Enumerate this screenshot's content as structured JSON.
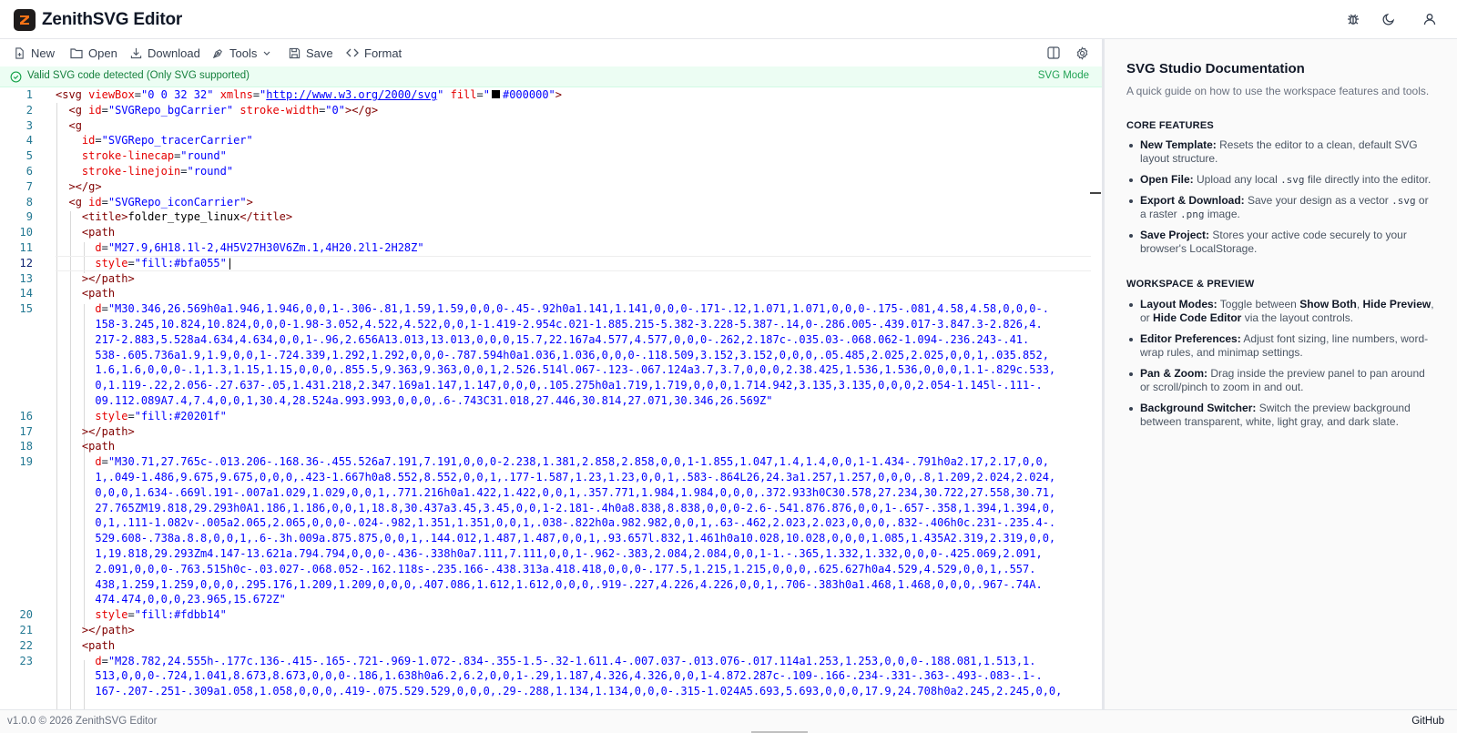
{
  "header": {
    "title": "ZenithSVG Editor",
    "logo_letter": "Z",
    "icons": [
      "bug-icon",
      "moon-icon",
      "user-icon"
    ]
  },
  "toolbar": {
    "new_label": "New",
    "open_label": "Open",
    "download_label": "Download",
    "tools_label": "Tools",
    "save_label": "Save",
    "format_label": "Format"
  },
  "status": {
    "message": "Valid SVG code detected (Only SVG supported)",
    "mode": "SVG Mode"
  },
  "editor": {
    "lines": [
      {
        "n": "1",
        "html": "<span class=\"punc\">&lt;</span><span class=\"tag\">svg</span> <span class=\"attr\">viewBox</span>=<span class=\"str\">\"0 0 32 32\"</span> <span class=\"attr\">xmlns</span>=<span class=\"str\">\"</span><span class=\"lnk\">http://www.w3.org/2000/svg</span><span class=\"str\">\"</span> <span class=\"attr\">fill</span>=<span class=\"str\">\"</span><span class=\"swatch\"></span><span class=\"str\">#000000\"</span><span class=\"punc\">&gt;</span>"
      },
      {
        "n": "2",
        "html": "  <span class=\"punc\">&lt;</span><span class=\"tag\">g</span> <span class=\"attr\">id</span>=<span class=\"str\">\"SVGRepo_bgCarrier\"</span> <span class=\"attr\">stroke-width</span>=<span class=\"str\">\"0\"</span><span class=\"punc\">&gt;&lt;/</span><span class=\"tag\">g</span><span class=\"punc\">&gt;</span>"
      },
      {
        "n": "3",
        "html": "  <span class=\"punc\">&lt;</span><span class=\"tag\">g</span>"
      },
      {
        "n": "4",
        "html": "    <span class=\"attr\">id</span>=<span class=\"str\">\"SVGRepo_tracerCarrier\"</span>"
      },
      {
        "n": "5",
        "html": "    <span class=\"attr\">stroke-linecap</span>=<span class=\"str\">\"round\"</span>"
      },
      {
        "n": "6",
        "html": "    <span class=\"attr\">stroke-linejoin</span>=<span class=\"str\">\"round\"</span>"
      },
      {
        "n": "7",
        "html": "  <span class=\"punc\">&gt;&lt;/</span><span class=\"tag\">g</span><span class=\"punc\">&gt;</span>"
      },
      {
        "n": "8",
        "html": "  <span class=\"punc\">&lt;</span><span class=\"tag\">g</span> <span class=\"attr\">id</span>=<span class=\"str\">\"SVGRepo_iconCarrier\"</span><span class=\"punc\">&gt;</span>"
      },
      {
        "n": "9",
        "html": "    <span class=\"punc\">&lt;</span><span class=\"tag\">title</span><span class=\"punc\">&gt;</span><span class=\"txt\">folder_type_linux</span><span class=\"punc\">&lt;/</span><span class=\"tag\">title</span><span class=\"punc\">&gt;</span>"
      },
      {
        "n": "10",
        "html": "    <span class=\"punc\">&lt;</span><span class=\"tag\">path</span>"
      },
      {
        "n": "11",
        "html": "      <span class=\"attr\">d</span>=<span class=\"str\">\"M27.9,6H18.1l-2,4H5V27H30V6Zm.1,4H20.2l1-2H28Z\"</span>"
      },
      {
        "n": "12",
        "html": "      <span class=\"attr\">style</span>=<span class=\"str\">\"fill:#bfa055\"</span><span class=\"txt\">|</span>"
      },
      {
        "n": "13",
        "html": "    <span class=\"punc\">&gt;&lt;/</span><span class=\"tag\">path</span><span class=\"punc\">&gt;</span>"
      },
      {
        "n": "14",
        "html": "    <span class=\"punc\">&lt;</span><span class=\"tag\">path</span>"
      },
      {
        "n": "15",
        "html": "      <span class=\"attr\">d</span>=<span class=\"str\">\"M30.346,26.569h0a1.946,1.946,0,0,1-.306-.81,1.59,1.59,0,0,0-.45-.92h0a1.141,1.141,0,0,0-.171-.12,1.071,1.071,0,0,0-.175-.081,4.58,4.58,0,0,0-.</span>"
      },
      {
        "n": "",
        "html": "      <span class=\"str\">158-3.245,10.824,10.824,0,0,0-1.98-3.052,4.522,4.522,0,0,1-1.419-2.954c.021-1.885.215-5.382-3.228-5.387-.14,0-.286.005-.439.017-3.847.3-2.826,4.</span>"
      },
      {
        "n": "",
        "html": "      <span class=\"str\">217-2.883,5.528a4.634,4.634,0,0,1-.96,2.656A13.013,13.013,0,0,0,15.7,22.167a4.577,4.577,0,0,0-.262,2.187c-.035.03-.068.062-1.094-.236.243-.41.</span>"
      },
      {
        "n": "",
        "html": "      <span class=\"str\">538-.605.736a1.9,1.9,0,0,1-.724.339,1.292,1.292,0,0,0-.787.594h0a1.036,1.036,0,0,0-.118.509,3.152,3.152,0,0,0,.05.485,2.025,2.025,0,0,1,.035.852,</span>"
      },
      {
        "n": "",
        "html": "      <span class=\"str\">1.6,1.6,0,0,0-.1,1.3,1.15,1.15,0,0,0,.855.5,9.363,9.363,0,0,1,2.526.514l.067-.123-.067.124a3.7,3.7,0,0,0,2.38.425,1.536,1.536,0,0,0,1.1-.829c.533,</span>"
      },
      {
        "n": "",
        "html": "      <span class=\"str\">0,1.119-.22,2.056-.27.637-.05,1.431.218,2.347.169a1.147,1.147,0,0,0,.105.275h0a1.719,1.719,0,0,0,1.714.942,3.135,3.135,0,0,0,2.054-1.145l-.111-.</span>"
      },
      {
        "n": "",
        "html": "      <span class=\"str\">09.112.089A7.4,7.4,0,0,1,30.4,28.524a.993.993,0,0,0,.6-.743C31.018,27.446,30.814,27.071,30.346,26.569Z\"</span>"
      },
      {
        "n": "16",
        "html": "      <span class=\"attr\">style</span>=<span class=\"str\">\"fill:#20201f\"</span>"
      },
      {
        "n": "17",
        "html": "    <span class=\"punc\">&gt;&lt;/</span><span class=\"tag\">path</span><span class=\"punc\">&gt;</span>"
      },
      {
        "n": "18",
        "html": "    <span class=\"punc\">&lt;</span><span class=\"tag\">path</span>"
      },
      {
        "n": "19",
        "html": "      <span class=\"attr\">d</span>=<span class=\"str\">\"M30.71,27.765c-.013.206-.168.36-.455.526a7.191,7.191,0,0,0-2.238,1.381,2.858,2.858,0,0,1-1.855,1.047,1.4,1.4,0,0,1-1.434-.791h0a2.17,2.17,0,0,</span>"
      },
      {
        "n": "",
        "html": "      <span class=\"str\">1,.049-1.486,9.675,9.675,0,0,0,.423-1.667h0a8.552,8.552,0,0,1,.177-1.587,1.23,1.23,0,0,1,.583-.864L26,24.3a1.257,1.257,0,0,0,.8,1.209,2.024,2.024,</span>"
      },
      {
        "n": "",
        "html": "      <span class=\"str\">0,0,0,1.634-.669l.191-.007a1.029,1.029,0,0,1,.771.216h0a1.422,1.422,0,0,1,.357.771,1.984,1.984,0,0,0,.372.933h0C30.578,27.234,30.722,27.558,30.71,</span>"
      },
      {
        "n": "",
        "html": "      <span class=\"str\">27.765ZM19.818,29.293h0A1.186,1.186,0,0,1,18.8,30.437a3.45,3.45,0,0,1-2.181-.4h0a8.838,8.838,0,0,0-2.6-.541.876.876,0,0,1-.657-.358,1.394,1.394,0,</span>"
      },
      {
        "n": "",
        "html": "      <span class=\"str\">0,1,.111-1.082v-.005a2.065,2.065,0,0,0-.024-.982,1.351,1.351,0,0,1,.038-.822h0a.982.982,0,0,1,.63-.462,2.023,2.023,0,0,0,.832-.406h0c.231-.235.4-.</span>"
      },
      {
        "n": "",
        "html": "      <span class=\"str\">529.608-.738a.8.8,0,0,1,.6-.3h.009a.875.875,0,0,1,.144.012,1.487,1.487,0,0,1,.93.657l.832,1.461h0a10.028,10.028,0,0,0,1.085,1.435A2.319,2.319,0,0,</span>"
      },
      {
        "n": "",
        "html": "      <span class=\"str\">1,19.818,29.293Zm4.147-13.621a.794.794,0,0,0-.436-.338h0a7.111,7.111,0,0,1-.962-.383,2.084,2.084,0,0,1-1.-.365,1.332,1.332,0,0,0-.425.069,2.091,</span>"
      },
      {
        "n": "",
        "html": "      <span class=\"str\">2.091,0,0,0-.763.515h0c-.03.027-.068.052-.162.118s-.235.166-.438.313a.418.418,0,0,0-.177.5,1.215,1.215,0,0,0,.625.627h0a4.529,4.529,0,0,1,.557.</span>"
      },
      {
        "n": "",
        "html": "      <span class=\"str\">438,1.259,1.259,0,0,0,.295.176,1.209,1.209,0,0,0,.407.086,1.612,1.612,0,0,0,.919-.227,4.226,4.226,0,0,1,.706-.383h0a1.468,1.468,0,0,0,.967-.74A.</span>"
      },
      {
        "n": "",
        "html": "      <span class=\"str\">474.474,0,0,0,23.965,15.672Z\"</span>"
      },
      {
        "n": "20",
        "html": "      <span class=\"attr\">style</span>=<span class=\"str\">\"fill:#fdbb14\"</span>"
      },
      {
        "n": "21",
        "html": "    <span class=\"punc\">&gt;&lt;/</span><span class=\"tag\">path</span><span class=\"punc\">&gt;</span>"
      },
      {
        "n": "22",
        "html": "    <span class=\"punc\">&lt;</span><span class=\"tag\">path</span>"
      },
      {
        "n": "23",
        "html": "      <span class=\"attr\">d</span>=<span class=\"str\">\"M28.782,24.555h-.177c.136-.415-.165-.721-.969-1.072-.834-.355-1.5-.32-1.611.4-.007.037-.013.076-.017.114a1.253,1.253,0,0,0-.188.081,1.513,1.</span>"
      },
      {
        "n": "",
        "html": "      <span class=\"str\">513,0,0,0-.724,1.041,8.673,8.673,0,0,0-.186,1.638h0a6.2,6.2,0,0,1-.29,1.187,4.326,4.326,0,0,1-4.872.287c-.109-.166-.234-.331-.363-.493-.083-.1-.</span>"
      },
      {
        "n": "",
        "html": "      <span class=\"str\">167-.207-.251-.309a1.058,1.058,0,0,0,.419-.075.529.529,0,0,0,.29-.288,1.134,1.134,0,0,0-.315-1.024A5.693,5.693,0,0,0,17.9,24.708h0a2.245,2.245,0,0,</span>"
      }
    ]
  },
  "docs": {
    "title": "SVG Studio Documentation",
    "subtitle": "A quick guide on how to use the workspace features and tools.",
    "core_heading": "CORE FEATURES",
    "core_items": [
      {
        "term": "New Template:",
        "text": " Resets the editor to a clean, default SVG layout structure."
      },
      {
        "term": "Open File:",
        "text": " Upload any local <span class=\"mono\">.svg</span> file directly into the editor."
      },
      {
        "term": "Export & Download:",
        "text": " Save your design as a vector <span class=\"mono\">.svg</span> or a raster <span class=\"mono\">.png</span> image."
      },
      {
        "term": "Save Project:",
        "text": " Stores your active code securely to your browser's LocalStorage."
      }
    ],
    "workspace_heading": "WORKSPACE & PREVIEW",
    "workspace_items": [
      {
        "term": "Layout Modes:",
        "text": " Toggle between <b>Show Both</b>, <b>Hide Preview</b>, or <b>Hide Code Editor</b> via the layout controls."
      },
      {
        "term": "Editor Preferences:",
        "text": " Adjust font sizing, line numbers, word-wrap rules, and minimap settings."
      },
      {
        "term": "Pan & Zoom:",
        "text": " Drag inside the preview panel to pan around or scroll/pinch to zoom in and out."
      },
      {
        "term": "Background Switcher:",
        "text": " Switch the preview background between transparent, white, light gray, and dark slate."
      }
    ]
  },
  "footer": {
    "version": "v1.0.0 © 2026 ZenithSVG Editor",
    "github": "GitHub"
  }
}
